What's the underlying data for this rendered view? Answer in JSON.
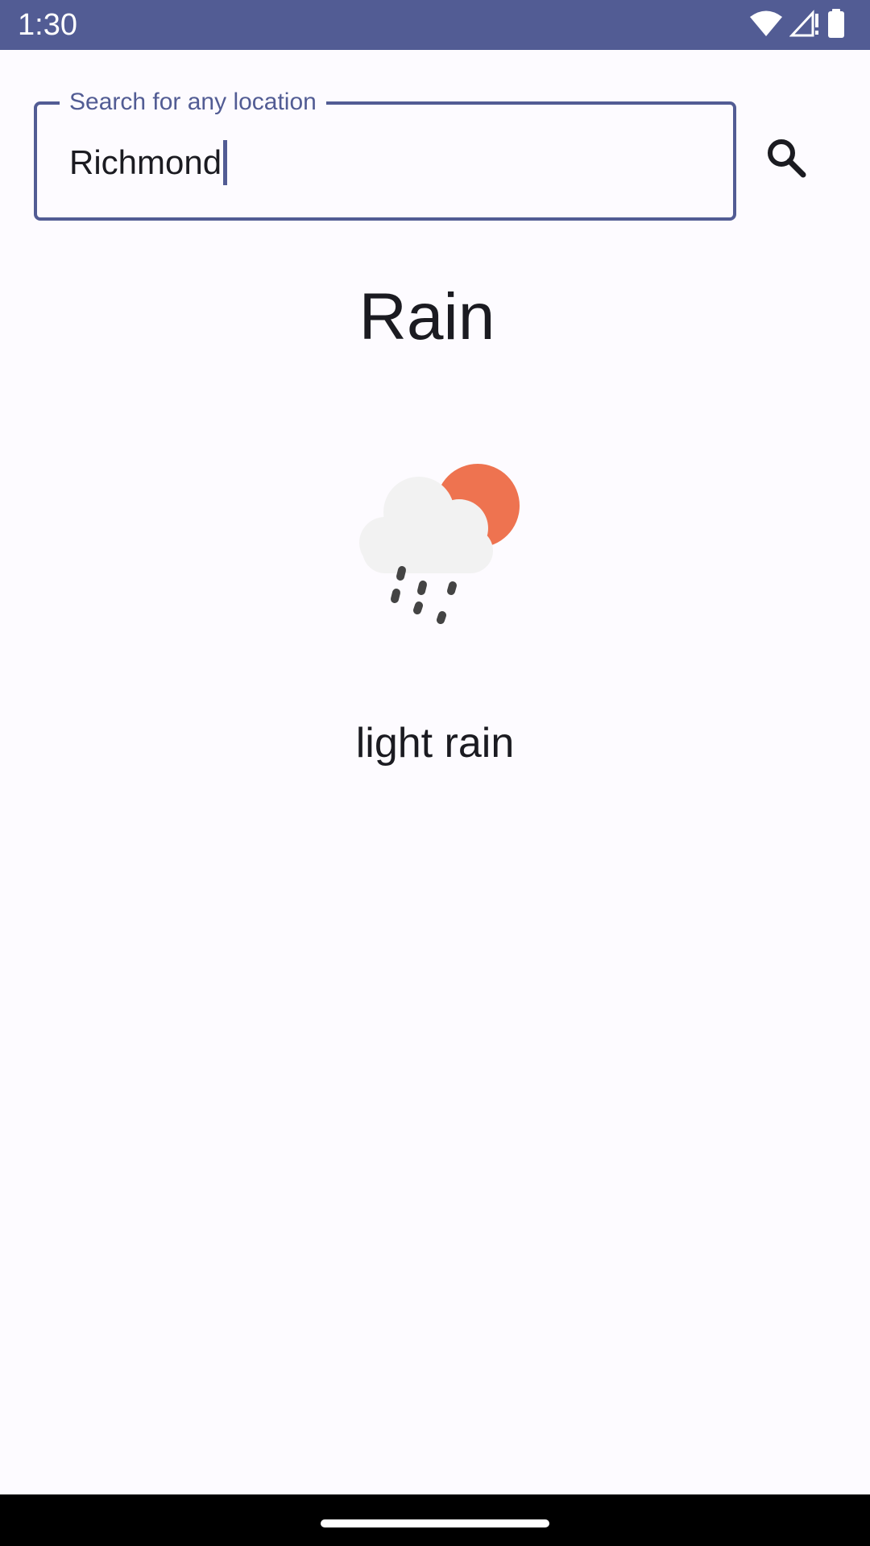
{
  "status_bar": {
    "time": "1:30",
    "icons": [
      "wifi-icon",
      "cell-signal-icon",
      "battery-icon"
    ],
    "color": "#525c94"
  },
  "search": {
    "label": "Search for any location",
    "value": "Richmond",
    "button_icon": "search-icon"
  },
  "weather": {
    "main": "Rain",
    "description": "light rain",
    "icon": "cloud-sun-rain-icon"
  },
  "colors": {
    "accent": "#525c94",
    "background": "#fdfbff",
    "sun": "#ee7350",
    "cloud": "#f2f2f2",
    "rain": "#444444"
  }
}
